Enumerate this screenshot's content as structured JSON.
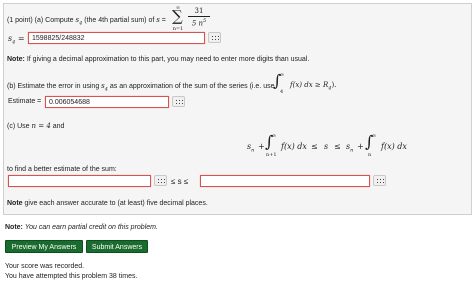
{
  "problem": {
    "points": "(1 point)",
    "part_a": {
      "label": "(a)",
      "text_before": "Compute",
      "text_mid": "(the 4th partial sum) of",
      "s_symbol": "s",
      "s4_symbol": "s",
      "sub4": "4",
      "equals": "=",
      "sum_top": "∞",
      "sum_bottom": "n=1",
      "numerator": "31",
      "denominator": "5 n",
      "exponent": "5",
      "answer_label": "s",
      "answer_sub": "4",
      "answer_value": "1598825/248832"
    },
    "note1_label": "Note:",
    "note1_text": "If giving a decimal approximation to this part, you may need to enter more digits than usual.",
    "part_b": {
      "label": "(b)",
      "text": "Estimate the error in using",
      "text2": "as an approximation of the sum of the series (i.e. use",
      "integral_lower": "4",
      "integral_upper": "∞",
      "integrand": "f(x) dx ≥ R",
      "r_sub": "4",
      "close": ").",
      "estimate_label": "Estimate =",
      "estimate_value": "0.006054688"
    },
    "part_c": {
      "label": "(c)",
      "text": "Use",
      "n_eq": "n = 4",
      "text_and": "and",
      "left_sn": "s",
      "left_sub": "n",
      "plus": "+",
      "int_left_lower": "n+1",
      "int_upper": "∞",
      "fx": "f(x) dx",
      "le1": "≤",
      "s_mid": "s",
      "le2": "≤",
      "right_sn": "s",
      "right_sub": "n",
      "plus2": "+",
      "int_right_lower": "n",
      "fx2": "f(x) dx",
      "find_text": "to find a better estimate of the sum:",
      "lower_value": "",
      "upper_value": "",
      "mid_relation": "≤ s ≤"
    },
    "note2_label": "Note",
    "note2_text": "give each answer accurate to (at least) five decimal places."
  },
  "partial_credit": {
    "label": "Note:",
    "text": "You can earn partial credit on this problem."
  },
  "buttons": {
    "preview": "Preview My Answers",
    "submit": "Submit Answers"
  },
  "status": {
    "recorded": "Your score was recorded.",
    "attempts": "You have attempted this problem 38 times."
  }
}
